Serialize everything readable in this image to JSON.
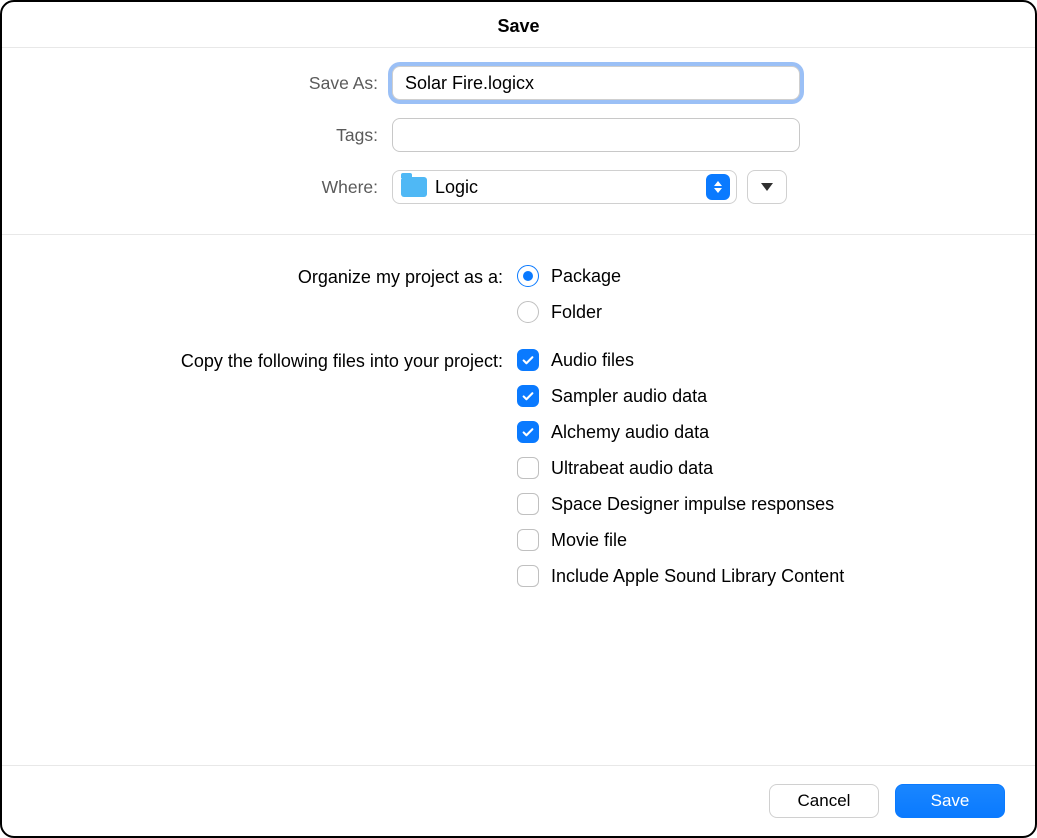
{
  "dialog": {
    "title": "Save"
  },
  "fields": {
    "save_as": {
      "label": "Save As:",
      "value": "Solar Fire.logicx"
    },
    "tags": {
      "label": "Tags:",
      "value": ""
    },
    "where": {
      "label": "Where:",
      "value": "Logic"
    }
  },
  "organize": {
    "label": "Organize my project as a:",
    "options": [
      {
        "label": "Package",
        "selected": true
      },
      {
        "label": "Folder",
        "selected": false
      }
    ]
  },
  "copy": {
    "label": "Copy the following files into your project:",
    "options": [
      {
        "label": "Audio files",
        "checked": true
      },
      {
        "label": "Sampler audio data",
        "checked": true
      },
      {
        "label": "Alchemy audio data",
        "checked": true
      },
      {
        "label": "Ultrabeat audio data",
        "checked": false
      },
      {
        "label": "Space Designer impulse responses",
        "checked": false
      },
      {
        "label": "Movie file",
        "checked": false
      },
      {
        "label": "Include Apple Sound Library Content",
        "checked": false
      }
    ]
  },
  "buttons": {
    "cancel": "Cancel",
    "save": "Save"
  }
}
